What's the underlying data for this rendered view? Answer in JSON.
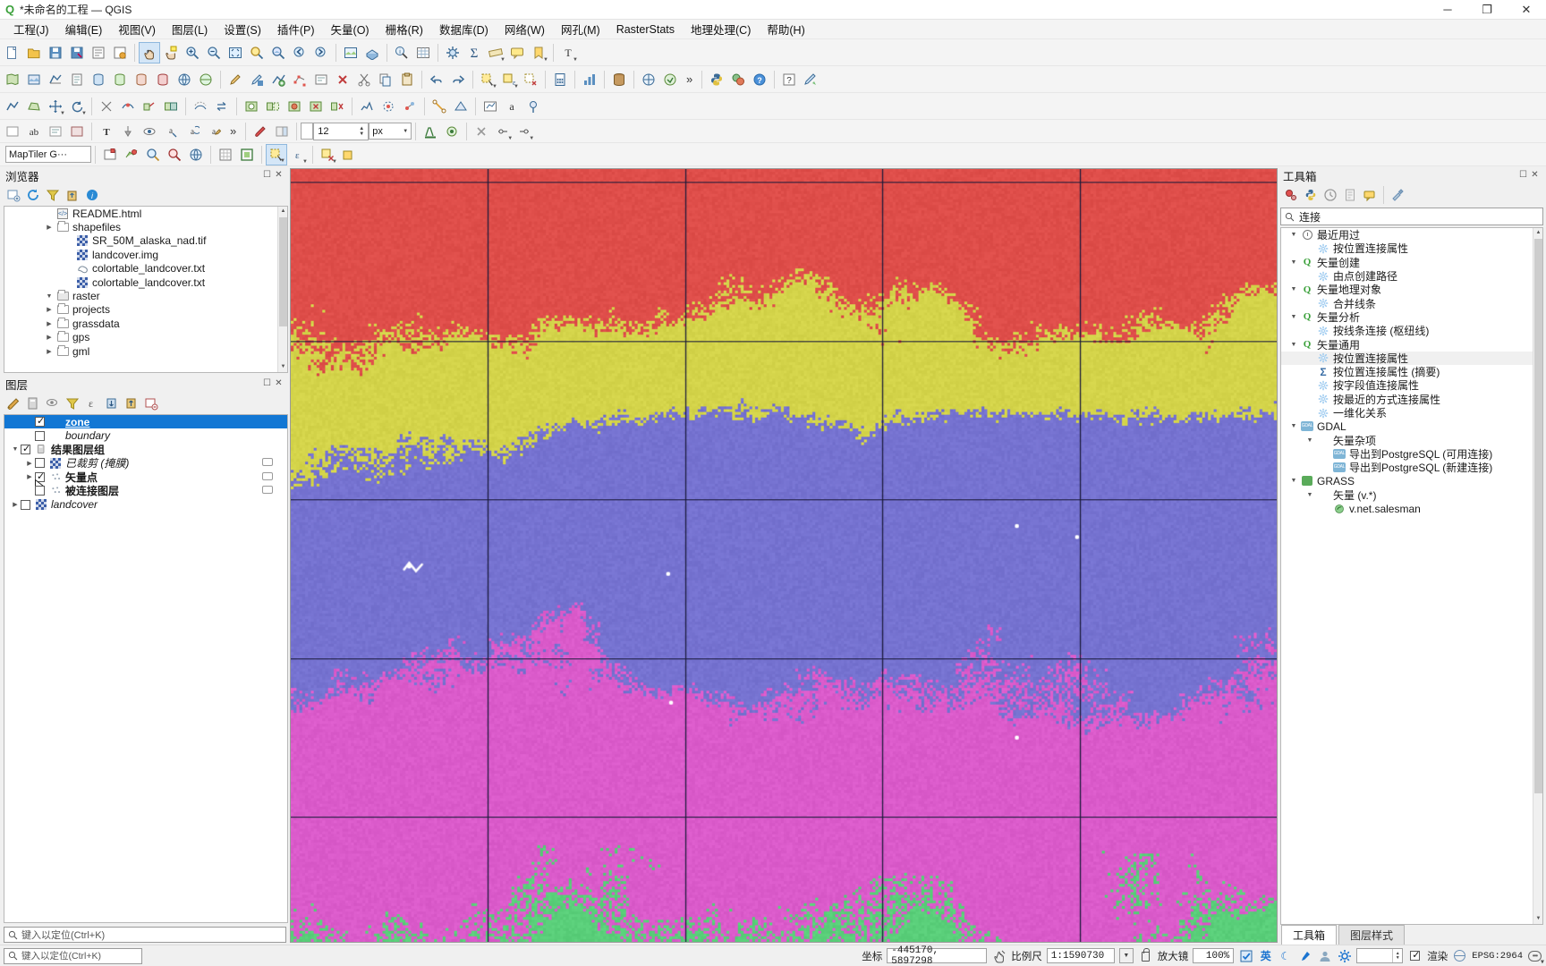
{
  "window": {
    "title": "*未命名的工程 — QGIS",
    "app_icon": "qgis-logo-icon",
    "minimize_label": "─",
    "maximize_label": "❐",
    "close_label": "✕"
  },
  "menubar": {
    "items": [
      {
        "label": "工程(J)",
        "name": "menu-project"
      },
      {
        "label": "编辑(E)",
        "name": "menu-edit"
      },
      {
        "label": "视图(V)",
        "name": "menu-view"
      },
      {
        "label": "图层(L)",
        "name": "menu-layer"
      },
      {
        "label": "设置(S)",
        "name": "menu-settings"
      },
      {
        "label": "插件(P)",
        "name": "menu-plugins"
      },
      {
        "label": "矢量(O)",
        "name": "menu-vector"
      },
      {
        "label": "栅格(R)",
        "name": "menu-raster"
      },
      {
        "label": "数据库(D)",
        "name": "menu-database"
      },
      {
        "label": "网络(W)",
        "name": "menu-web"
      },
      {
        "label": "网孔(M)",
        "name": "menu-mesh"
      },
      {
        "label": "RasterStats",
        "name": "menu-rasterstats"
      },
      {
        "label": "地理处理(C)",
        "name": "menu-geoprocessing"
      },
      {
        "label": "帮助(H)",
        "name": "menu-help"
      }
    ]
  },
  "toolbar4": {
    "maptiler_label": "MapTiler G···",
    "font_size": "12",
    "font_unit": "px"
  },
  "browser": {
    "title": "浏览器",
    "tools": [
      "add-layer-icon",
      "refresh-icon",
      "filter-icon",
      "collapse-all-icon",
      "properties-icon"
    ],
    "items": [
      {
        "label": "gml",
        "icon": "folder-icon",
        "indent": 1,
        "arrow": "closed"
      },
      {
        "label": "gps",
        "icon": "folder-icon",
        "indent": 1,
        "arrow": "closed"
      },
      {
        "label": "grassdata",
        "icon": "folder-icon",
        "indent": 1,
        "arrow": "closed"
      },
      {
        "label": "projects",
        "icon": "folder-icon",
        "indent": 1,
        "arrow": "closed"
      },
      {
        "label": "raster",
        "icon": "folder-open-icon",
        "indent": 1,
        "arrow": "open"
      },
      {
        "label": "colortable_landcover.txt",
        "icon": "raster-icon",
        "indent": 2,
        "arrow": "none"
      },
      {
        "label": "colortable_landcover.txt",
        "icon": "vector-icon",
        "indent": 2,
        "arrow": "none"
      },
      {
        "label": "landcover.img",
        "icon": "raster-icon",
        "indent": 2,
        "arrow": "none"
      },
      {
        "label": "SR_50M_alaska_nad.tif",
        "icon": "raster-icon",
        "indent": 2,
        "arrow": "none"
      },
      {
        "label": "shapefiles",
        "icon": "folder-icon",
        "indent": 1,
        "arrow": "closed"
      },
      {
        "label": "README.html",
        "icon": "html-icon",
        "indent": 1,
        "arrow": "none"
      }
    ]
  },
  "layers": {
    "title": "图层",
    "tools": [
      "open-layer-styling-icon",
      "add-group-icon",
      "manage-visibility-icon",
      "filter-legend-icon",
      "expression-filter-icon",
      "expand-all-icon",
      "collapse-all-icon",
      "remove-layer-icon"
    ],
    "items": [
      {
        "label": "zone",
        "indent": 1,
        "arrow": "none",
        "checked": true,
        "selected": true,
        "italic": false,
        "icon": "polygon-layer-icon"
      },
      {
        "label": "boundary",
        "indent": 1,
        "arrow": "none",
        "checked": false,
        "selected": false,
        "italic": true,
        "icon": "polygon-layer-icon"
      },
      {
        "label": "结果图层组",
        "indent": 0,
        "arrow": "open",
        "checked": true,
        "selected": false,
        "italic": false,
        "icon": "group-icon"
      },
      {
        "label": "已裁剪 (掩膜)",
        "indent": 1,
        "arrow": "closed",
        "checked": false,
        "selected": false,
        "italic": true,
        "icon": "raster-icon"
      },
      {
        "label": "矢量点",
        "indent": 1,
        "arrow": "closed",
        "checked": true,
        "selected": false,
        "italic": false,
        "icon": "point-layer-icon"
      },
      {
        "label": "被连接图层",
        "indent": 1,
        "arrow": "none",
        "checked": false,
        "selected": false,
        "italic": false,
        "icon": "point-layer-icon"
      },
      {
        "label": "landcover",
        "indent": 0,
        "arrow": "closed",
        "checked": false,
        "selected": false,
        "italic": true,
        "icon": "raster-icon"
      }
    ]
  },
  "locator": {
    "placeholder": "键入以定位(Ctrl+K)",
    "icon": "search-icon"
  },
  "toolbox": {
    "title": "工具箱",
    "tools": [
      "models-icon",
      "python-script-icon",
      "history-icon",
      "results-icon",
      "edit-help-icon",
      "options-icon"
    ],
    "search": {
      "value": "连接",
      "icon": "search-icon"
    },
    "items": [
      {
        "label": "最近用过",
        "icon": "clock-icon",
        "indent": 0,
        "arrow": "open"
      },
      {
        "label": "按位置连接属性",
        "icon": "alg-icon",
        "indent": 1,
        "arrow": "none"
      },
      {
        "label": "矢量创建",
        "icon": "qgis-icon",
        "indent": 0,
        "arrow": "open"
      },
      {
        "label": "由点创建路径",
        "icon": "alg-icon",
        "indent": 1,
        "arrow": "none"
      },
      {
        "label": "矢量地理对象",
        "icon": "qgis-icon",
        "indent": 0,
        "arrow": "open"
      },
      {
        "label": "合并线条",
        "icon": "alg-icon",
        "indent": 1,
        "arrow": "none"
      },
      {
        "label": "矢量分析",
        "icon": "qgis-icon",
        "indent": 0,
        "arrow": "open"
      },
      {
        "label": "按线条连接 (枢纽线)",
        "icon": "alg-icon",
        "indent": 1,
        "arrow": "none"
      },
      {
        "label": "矢量通用",
        "icon": "qgis-icon",
        "indent": 0,
        "arrow": "open"
      },
      {
        "label": "按位置连接属性",
        "icon": "alg-icon",
        "indent": 1,
        "arrow": "none",
        "highlight": true
      },
      {
        "label": "按位置连接属性 (摘要)",
        "icon": "sigma-icon",
        "indent": 1,
        "arrow": "none"
      },
      {
        "label": "按字段值连接属性",
        "icon": "alg-icon",
        "indent": 1,
        "arrow": "none"
      },
      {
        "label": "按最近的方式连接属性",
        "icon": "alg-icon",
        "indent": 1,
        "arrow": "none"
      },
      {
        "label": "一维化关系",
        "icon": "alg-icon",
        "indent": 1,
        "arrow": "none"
      },
      {
        "label": "GDAL",
        "icon": "gdal-icon",
        "indent": 0,
        "arrow": "open"
      },
      {
        "label": "矢量杂项",
        "icon": "none",
        "indent": 1,
        "arrow": "open"
      },
      {
        "label": "导出到PostgreSQL (可用连接)",
        "icon": "gdal-icon",
        "indent": 2,
        "arrow": "none"
      },
      {
        "label": "导出到PostgreSQL (新建连接)",
        "icon": "gdal-icon",
        "indent": 2,
        "arrow": "none"
      },
      {
        "label": "GRASS",
        "icon": "grass-icon",
        "indent": 0,
        "arrow": "open"
      },
      {
        "label": "矢量 (v.*)",
        "icon": "none",
        "indent": 1,
        "arrow": "open"
      },
      {
        "label": "v.net.salesman",
        "icon": "grass-alg-icon",
        "indent": 2,
        "arrow": "none"
      }
    ],
    "tabs": [
      {
        "label": "工具箱",
        "active": true,
        "name": "tab-toolbox"
      },
      {
        "label": "图层样式",
        "active": false,
        "name": "tab-layer-styling"
      }
    ]
  },
  "statusbar": {
    "coordinate_label": "坐标",
    "coordinate_value": "-445170, 5897298",
    "pan_icon": "pan-extent-icon",
    "scale_label": "比例尺",
    "scale_value": "1:1590730",
    "scale_arrow": "▼",
    "lock_icon": "lock-icon",
    "magnifier_label": "放大镜",
    "magnifier_value": "100%",
    "rotation_value": "",
    "render_label": "渲染",
    "render_checked": true,
    "crs_label": "EPSG:2964",
    "messages_icon": "messages-icon",
    "ime_icons": [
      "checkbox-blue-icon",
      "chinese-ime-icon",
      "moon-icon",
      "pen-icon",
      "user-icon",
      "gear-icon"
    ]
  },
  "colors": {
    "selection_blue": "#1277d4",
    "panel_bg": "#f0f0f0",
    "accent_green": "#3aa03a"
  },
  "map": {
    "grid_color": "#1a1a3a",
    "palette": [
      "#e4534f",
      "#d9d94f",
      "#7b78d6",
      "#e060d0",
      "#5fd47f",
      "#e08a5a",
      "#d6d6a0"
    ]
  }
}
